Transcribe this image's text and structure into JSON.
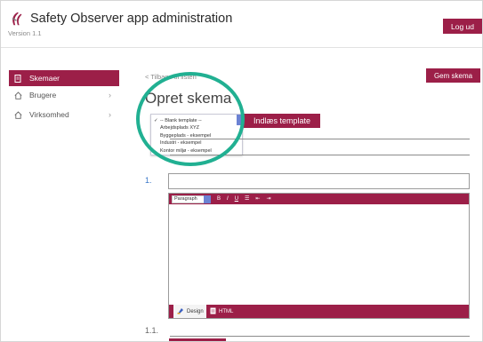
{
  "app": {
    "title": "Safety Observer app administration",
    "version": "Version 1.1"
  },
  "header": {
    "logout_label": "Log ud"
  },
  "sidebar": {
    "items": [
      {
        "label": "Skemaer",
        "icon": "form-icon",
        "active": true,
        "has_chevron": false
      },
      {
        "label": "Brugere",
        "icon": "home-icon",
        "active": false,
        "has_chevron": true
      },
      {
        "label": "Virksomhed",
        "icon": "home-icon",
        "active": false,
        "has_chevron": true
      }
    ]
  },
  "main": {
    "back_link": "< Tilbage til listen",
    "page_title": "Opret skema",
    "save_label": "Gem skema",
    "import_label": "Indlæs template",
    "template_dropdown": {
      "options": [
        {
          "label": "-- Blank template --",
          "selected": true
        },
        {
          "label": "Arbejdsplads XYZ",
          "selected": false
        },
        {
          "label": "Byggeplads - eksempel",
          "selected": false
        },
        {
          "label": "Industri - eksempel",
          "selected": false
        },
        {
          "label": "Kontor miljø - eksempel",
          "selected": false
        }
      ]
    },
    "question_number": "1.",
    "sub_number": "1.1.",
    "editor": {
      "format_select": "Paragraph",
      "toolbar": {
        "bold": "B",
        "italic": "I",
        "underline": "U",
        "bullets": "☰",
        "outdent": "⇤",
        "indent": "⇥"
      },
      "tabs": {
        "design": "Design",
        "html": "HTML"
      }
    }
  },
  "colors": {
    "accent": "#9c1f48",
    "highlight": "#21b092",
    "link": "#3a78c9"
  }
}
